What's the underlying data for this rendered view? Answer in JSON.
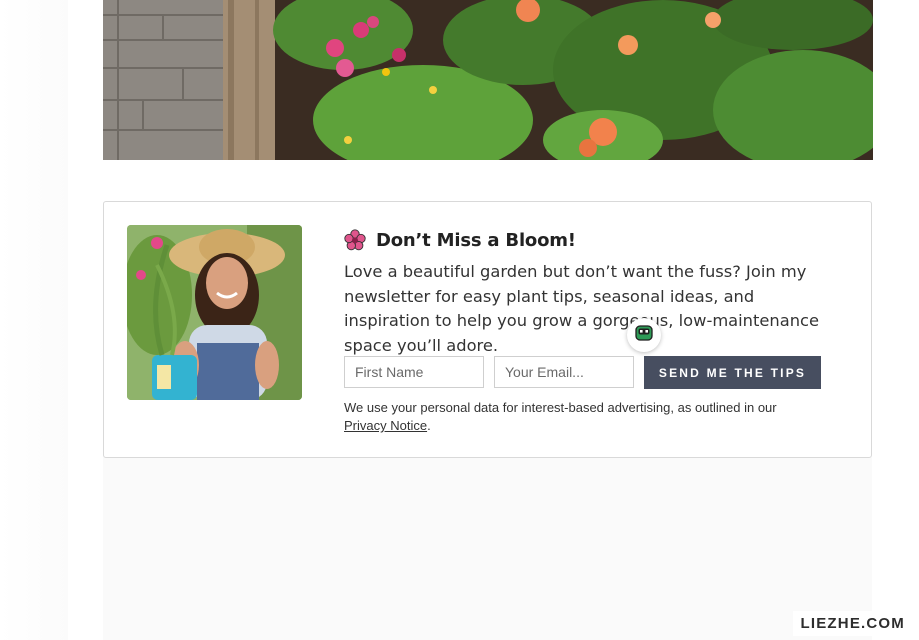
{
  "hero": {
    "image_name": "garden-bed-photo"
  },
  "newsletter": {
    "icon": "flower-icon",
    "title": "Don’t Miss a Bloom!",
    "description": "Love a beautiful garden but don’t want the fuss? Join my newsletter for easy plant tips, seasonal ideas, and inspiration to help you grow a gorgeous, low-maintenance space you’ll adore.",
    "first_name_placeholder": "First Name",
    "email_placeholder": "Your Email...",
    "submit_label": "SEND ME THE TIPS",
    "legal_text": "We use your personal data for interest-based advertising, as outlined in our",
    "privacy_link": "Privacy Notice",
    "legal_end": "."
  },
  "widget": {
    "icon": "bot-face-icon"
  },
  "watermark": "LIEZHE.COM",
  "colors": {
    "button": "#474e60",
    "card_border": "#d9d9d9",
    "flower_icon": "#e0558c"
  }
}
